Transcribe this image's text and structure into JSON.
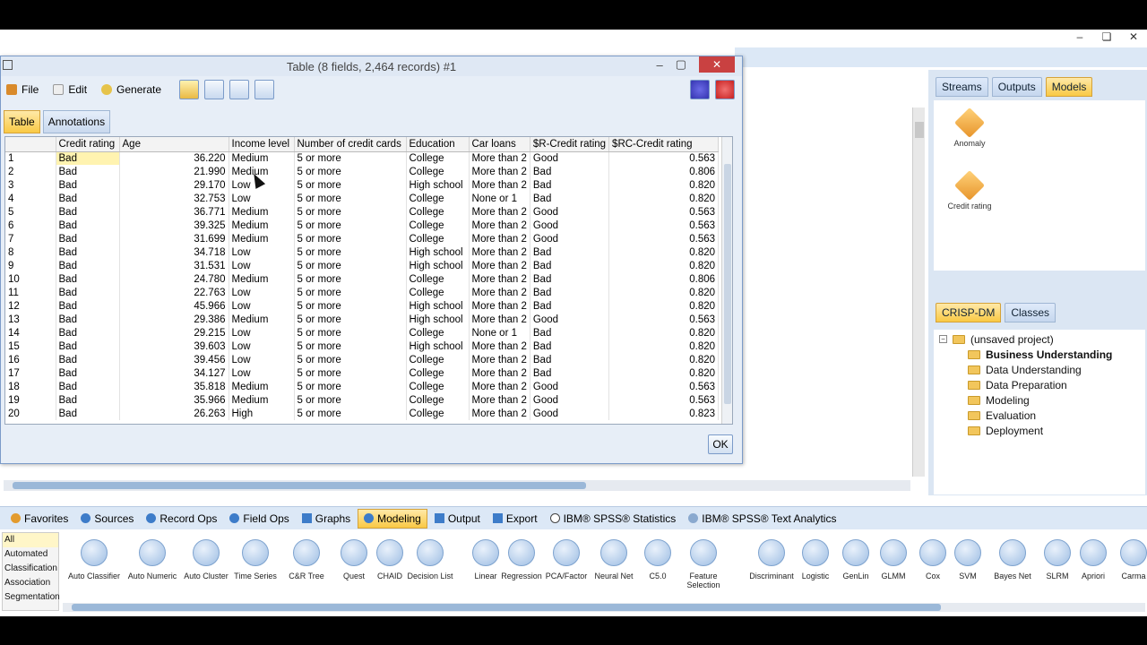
{
  "main_window": {
    "controls": [
      "–",
      "❏",
      "✕"
    ]
  },
  "dialog": {
    "title": "Table (8 fields, 2,464 records) #1",
    "menu": {
      "file": "File",
      "edit": "Edit",
      "generate": "Generate"
    },
    "tabs": {
      "table": "Table",
      "annotations": "Annotations"
    },
    "ok": "OK",
    "columns": [
      "",
      "Credit rating",
      "Age",
      "Income level",
      "Number of credit cards",
      "Education",
      "Car loans",
      "$R-Credit rating",
      "$RC-Credit rating"
    ],
    "rows": [
      [
        "1",
        "Bad",
        "36.220",
        "Medium",
        "5 or more",
        "College",
        "More than 2",
        "Good",
        "0.563"
      ],
      [
        "2",
        "Bad",
        "21.990",
        "Medium",
        "5 or more",
        "College",
        "More than 2",
        "Bad",
        "0.806"
      ],
      [
        "3",
        "Bad",
        "29.170",
        "Low",
        "5 or more",
        "High school",
        "More than 2",
        "Bad",
        "0.820"
      ],
      [
        "4",
        "Bad",
        "32.753",
        "Low",
        "5 or more",
        "College",
        "None or 1",
        "Bad",
        "0.820"
      ],
      [
        "5",
        "Bad",
        "36.771",
        "Medium",
        "5 or more",
        "College",
        "More than 2",
        "Good",
        "0.563"
      ],
      [
        "6",
        "Bad",
        "39.325",
        "Medium",
        "5 or more",
        "College",
        "More than 2",
        "Good",
        "0.563"
      ],
      [
        "7",
        "Bad",
        "31.699",
        "Medium",
        "5 or more",
        "College",
        "More than 2",
        "Good",
        "0.563"
      ],
      [
        "8",
        "Bad",
        "34.718",
        "Low",
        "5 or more",
        "High school",
        "More than 2",
        "Bad",
        "0.820"
      ],
      [
        "9",
        "Bad",
        "31.531",
        "Low",
        "5 or more",
        "High school",
        "More than 2",
        "Bad",
        "0.820"
      ],
      [
        "10",
        "Bad",
        "24.780",
        "Medium",
        "5 or more",
        "College",
        "More than 2",
        "Bad",
        "0.806"
      ],
      [
        "11",
        "Bad",
        "22.763",
        "Low",
        "5 or more",
        "College",
        "More than 2",
        "Bad",
        "0.820"
      ],
      [
        "12",
        "Bad",
        "45.966",
        "Low",
        "5 or more",
        "High school",
        "More than 2",
        "Bad",
        "0.820"
      ],
      [
        "13",
        "Bad",
        "29.386",
        "Medium",
        "5 or more",
        "High school",
        "More than 2",
        "Good",
        "0.563"
      ],
      [
        "14",
        "Bad",
        "29.215",
        "Low",
        "5 or more",
        "College",
        "None or 1",
        "Bad",
        "0.820"
      ],
      [
        "15",
        "Bad",
        "39.603",
        "Low",
        "5 or more",
        "High school",
        "More than 2",
        "Bad",
        "0.820"
      ],
      [
        "16",
        "Bad",
        "39.456",
        "Low",
        "5 or more",
        "College",
        "More than 2",
        "Bad",
        "0.820"
      ],
      [
        "17",
        "Bad",
        "34.127",
        "Low",
        "5 or more",
        "College",
        "More than 2",
        "Bad",
        "0.820"
      ],
      [
        "18",
        "Bad",
        "35.818",
        "Medium",
        "5 or more",
        "College",
        "More than 2",
        "Good",
        "0.563"
      ],
      [
        "19",
        "Bad",
        "35.966",
        "Medium",
        "5 or more",
        "College",
        "More than 2",
        "Good",
        "0.563"
      ],
      [
        "20",
        "Bad",
        "26.263",
        "High",
        "5 or more",
        "College",
        "More than 2",
        "Good",
        "0.823"
      ]
    ]
  },
  "right_panel": {
    "tabs": {
      "streams": "Streams",
      "outputs": "Outputs",
      "models": "Models"
    },
    "models": {
      "anomaly": "Anomaly",
      "credit_rating": "Credit rating"
    },
    "project_tabs": {
      "crisp": "CRISP-DM",
      "classes": "Classes"
    },
    "project_root": "(unsaved project)",
    "phases": [
      "Business Understanding",
      "Data Understanding",
      "Data Preparation",
      "Modeling",
      "Evaluation",
      "Deployment"
    ]
  },
  "palette": {
    "tabs": [
      "Favorites",
      "Sources",
      "Record Ops",
      "Field Ops",
      "Graphs",
      "Modeling",
      "Output",
      "Export",
      "IBM® SPSS® Statistics",
      "IBM® SPSS® Text Analytics"
    ],
    "categories": [
      "All",
      "Automated",
      "Classification",
      "Association",
      "Segmentation"
    ],
    "nodes": [
      "Auto Classifier",
      "Auto Numeric",
      "Auto Cluster",
      "Time Series",
      "C&R Tree",
      "Quest",
      "CHAID",
      "Decision List",
      "Linear",
      "Regression",
      "PCA/Factor",
      "Neural Net",
      "C5.0",
      "Feature Selection",
      "Discriminant",
      "Logistic",
      "GenLin",
      "GLMM",
      "Cox",
      "SVM",
      "Bayes Net",
      "SLRM",
      "Apriori",
      "Carma"
    ]
  }
}
